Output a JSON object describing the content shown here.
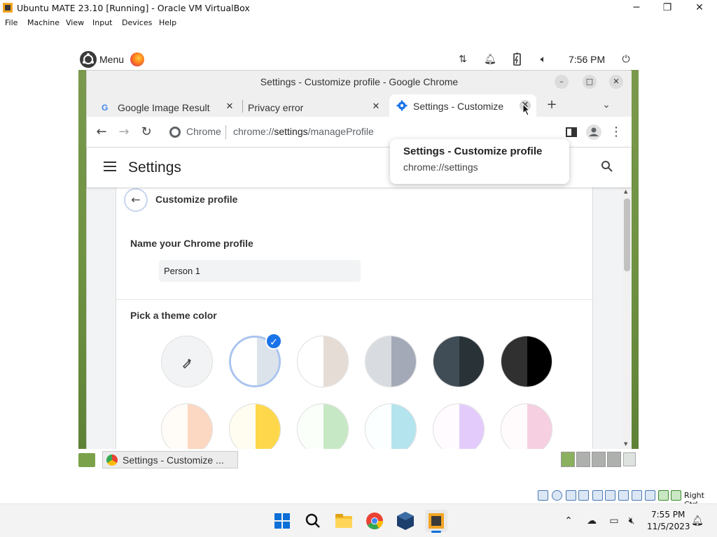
{
  "vbox": {
    "title": "Ubuntu MATE 23.10 [Running] - Oracle VM VirtualBox",
    "menu": [
      "File",
      "Machine",
      "View",
      "Input",
      "Devices",
      "Help"
    ],
    "host_key": "Right Ctrl"
  },
  "mate_panel": {
    "menu_label": "Menu",
    "clock": "7:56 PM"
  },
  "chrome": {
    "window_title": "Settings - Customize profile - Google Chrome",
    "tabs": [
      {
        "label": "Google Image Result"
      },
      {
        "label": "Privacy error"
      },
      {
        "label": "Settings - Customize"
      }
    ],
    "omnibox": {
      "site": "Chrome",
      "url_prefix": "chrome://",
      "url_host": "settings",
      "url_path": "/manageProfile"
    },
    "tooltip": {
      "title": "Settings - Customize profile",
      "url": "chrome://settings"
    }
  },
  "settings": {
    "title": "Settings",
    "page_title": "Customize profile",
    "name_label": "Name your Chrome profile",
    "name_value": "Person 1",
    "theme_label": "Pick a theme color",
    "swatches": [
      {
        "left": "#f1f3f4",
        "right": "#f1f3f4"
      },
      {
        "left": "#ffffff",
        "right": "#dde3ea"
      },
      {
        "left": "#ffffff",
        "right": "#e6dcd6"
      },
      {
        "left": "#d8dbe0",
        "right": "#a3a9b7"
      },
      {
        "left": "#414d56",
        "right": "#283237"
      },
      {
        "left": "#303030",
        "right": "#000000"
      },
      {
        "left": "#fffbf7",
        "right": "#fcd7c2"
      },
      {
        "left": "#fffdf0",
        "right": "#fed84a"
      },
      {
        "left": "#fafffa",
        "right": "#c7e8c4"
      },
      {
        "left": "#fbffff",
        "right": "#b4e4ed"
      },
      {
        "left": "#fffbff",
        "right": "#e3ccfc"
      },
      {
        "left": "#fffbfd",
        "right": "#f6cfe1"
      }
    ]
  },
  "mate_taskbar": {
    "task_label": "Settings - Customize ..."
  },
  "windows": {
    "clock_time": "7:55 PM",
    "clock_date": "11/5/2023"
  }
}
